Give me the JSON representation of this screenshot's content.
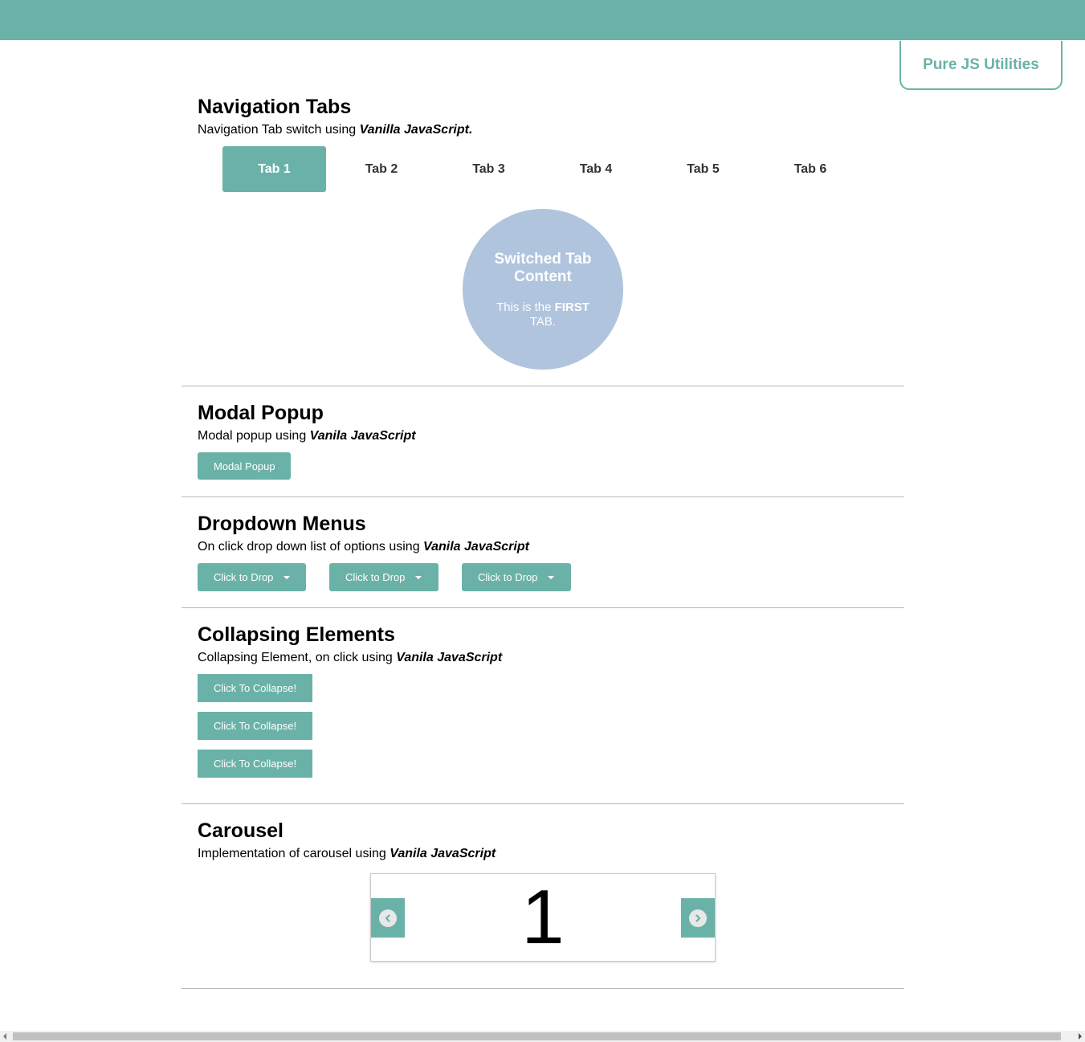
{
  "header": {
    "brand": "Pure JS Utilities",
    "color": "#6ab2a7"
  },
  "tabs_section": {
    "title": "Navigation Tabs",
    "desc_prefix": "Navigation Tab switch using ",
    "desc_em": "Vanilla JavaScript.",
    "tabs": [
      {
        "label": "Tab 1",
        "active": true
      },
      {
        "label": "Tab 2",
        "active": false
      },
      {
        "label": "Tab 3",
        "active": false
      },
      {
        "label": "Tab 4",
        "active": false
      },
      {
        "label": "Tab 5",
        "active": false
      },
      {
        "label": "Tab 6",
        "active": false
      }
    ],
    "content_title": "Switched Tab Content",
    "content_prefix": "This is the ",
    "content_bold": "FIRST",
    "content_suffix": " TAB.",
    "content_color": "#b0c4de"
  },
  "modal_section": {
    "title": "Modal Popup",
    "desc_prefix": "Modal popup using ",
    "desc_em": "Vanila JavaScript",
    "button": "Modal Popup"
  },
  "dropdown_section": {
    "title": "Dropdown Menus",
    "desc_prefix": "On click drop down list of options using ",
    "desc_em": "Vanila JavaScript",
    "buttons": [
      "Click to Drop",
      "Click to Drop",
      "Click to Drop"
    ]
  },
  "collapse_section": {
    "title": "Collapsing Elements",
    "desc_prefix": "Collapsing Element, on click using ",
    "desc_em": "Vanila JavaScript",
    "buttons": [
      "Click To Collapse!",
      "Click To Collapse!",
      "Click To Collapse!"
    ]
  },
  "carousel_section": {
    "title": "Carousel",
    "desc_prefix": "Implementation of carousel using ",
    "desc_em": "Vanila JavaScript",
    "slide": "1",
    "prev_icon": "chevron-left-circle-icon",
    "next_icon": "chevron-right-circle-icon"
  }
}
